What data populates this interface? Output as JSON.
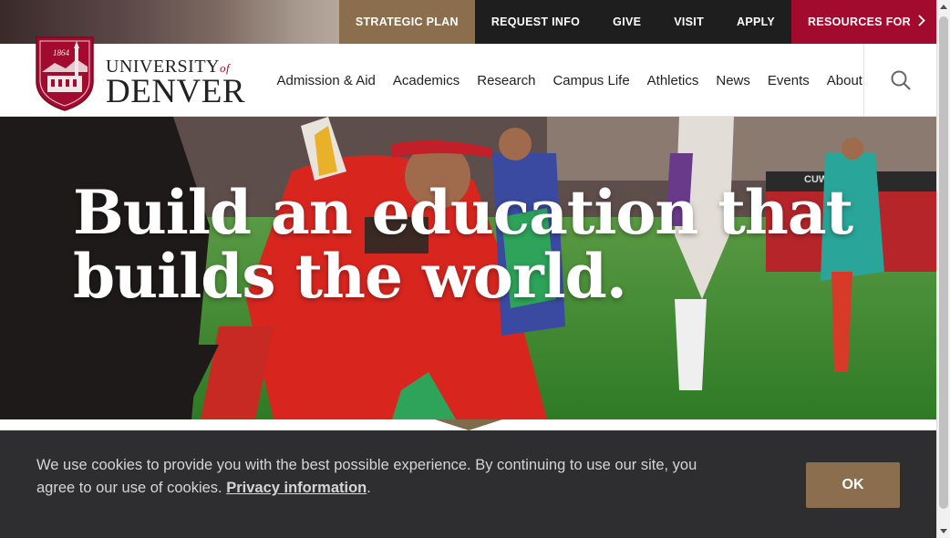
{
  "utility_nav": {
    "items": [
      {
        "label": "STRATEGIC PLAN"
      },
      {
        "label": "REQUEST INFO"
      },
      {
        "label": "GIVE"
      },
      {
        "label": "VISIT"
      },
      {
        "label": "APPLY"
      },
      {
        "label": "RESOURCES FOR"
      }
    ]
  },
  "logo": {
    "year": "1864",
    "wordmark_top": "UNIVERSITY",
    "wordmark_of": "of",
    "wordmark_bottom": "DENVER"
  },
  "main_nav": {
    "items": [
      {
        "label": "Admission & Aid"
      },
      {
        "label": "Academics"
      },
      {
        "label": "Research"
      },
      {
        "label": "Campus Life"
      },
      {
        "label": "Athletics"
      },
      {
        "label": "News"
      },
      {
        "label": "Events"
      },
      {
        "label": "About"
      }
    ]
  },
  "hero": {
    "title_line1": "Build an education that",
    "title_line2": "builds the world.",
    "banner_sign": "CUW"
  },
  "cookie_banner": {
    "text": "We use cookies to provide you with the best possible experience. By continuing to use our site, you agree to our use of cookies.",
    "link": "Privacy information",
    "button": "OK"
  },
  "colors": {
    "crimson": "#a30b2e",
    "gold": "#8b6e4e",
    "dark": "#1e1e1e",
    "banner_bg": "#2e2e30"
  },
  "icons": {
    "search": "search-icon",
    "chevron": "chevron-right-icon"
  }
}
